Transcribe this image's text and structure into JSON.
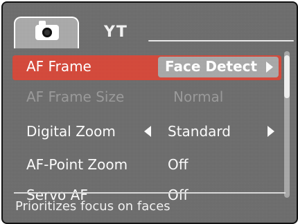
{
  "tabs": {
    "settings_label": "YT"
  },
  "menu": {
    "items": [
      {
        "label": "AF Frame",
        "value": "Face Detect",
        "state": "selected"
      },
      {
        "label": "AF Frame Size",
        "value": "Normal",
        "state": "disabled"
      },
      {
        "label": "Digital Zoom",
        "value": "Standard",
        "state": "normal"
      },
      {
        "label": "AF-Point Zoom",
        "value": "Off",
        "state": "normal"
      },
      {
        "label": "Servo AF",
        "value": "Off",
        "state": "normal"
      }
    ]
  },
  "help": {
    "text": "Prioritizes focus on faces"
  },
  "icons": {
    "camera_tab_icon": "camera-icon",
    "settings_tab_icon": "settings-tools-icon",
    "left": "left-arrow-icon",
    "right": "right-arrow-icon"
  },
  "colors": {
    "selected_row": "#d34a3c",
    "background": "#6e6e6e"
  }
}
